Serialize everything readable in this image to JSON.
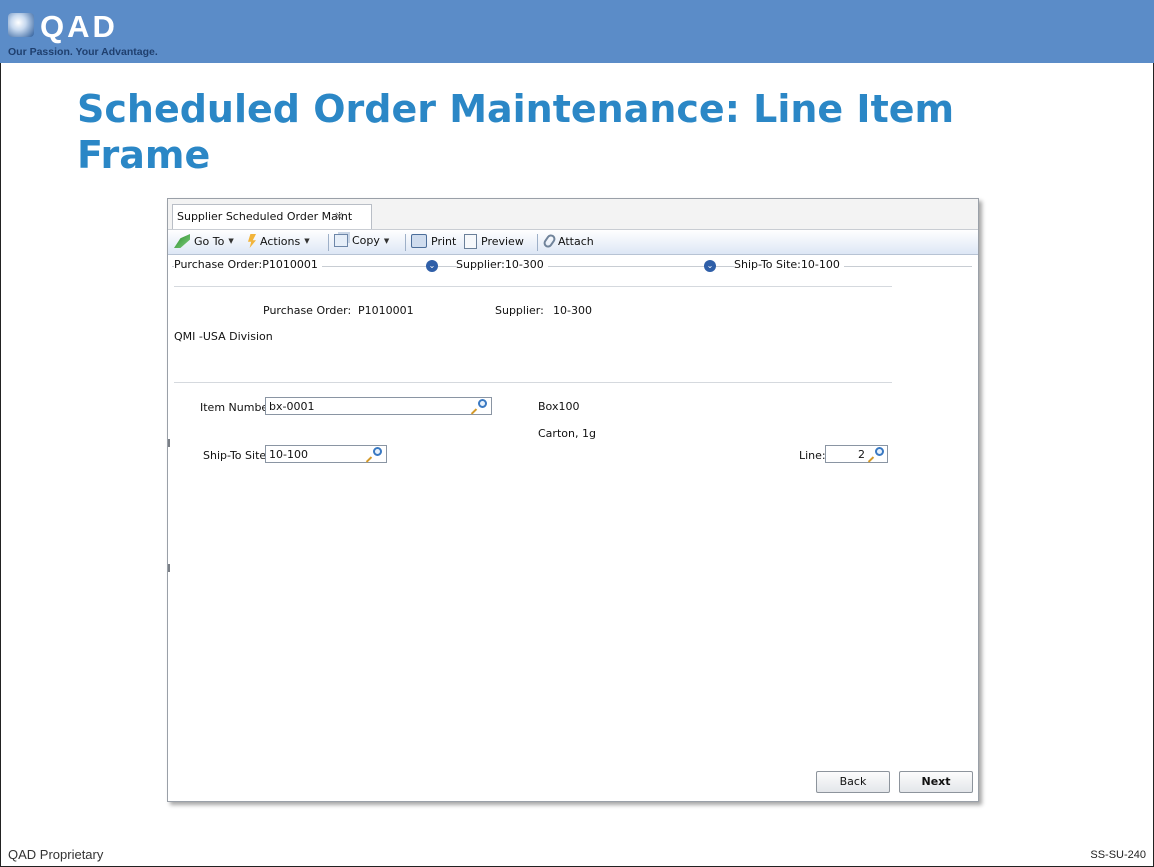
{
  "header": {
    "logo_text": "QAD",
    "tagline": "Our Passion. Your Advantage."
  },
  "slide": {
    "title": "Scheduled Order Maintenance: Line Item Frame"
  },
  "footer": {
    "left": "QAD Proprietary",
    "right": "SS-SU-240"
  },
  "app": {
    "tab_label": "Supplier Scheduled Order Maint",
    "tab_close": "×",
    "toolbar": {
      "goto": "Go To",
      "actions": "Actions",
      "copy": "Copy",
      "print": "Print",
      "preview": "Preview",
      "attach": "Attach"
    },
    "breadcrumb": {
      "purchase_order": "Purchase Order:P1010001",
      "supplier": "Supplier:10-300",
      "ship_to_site": "Ship-To Site:10-100"
    },
    "header_info": {
      "po_label": "Purchase Order:",
      "po_value": "P1010001",
      "supplier_label": "Supplier:",
      "supplier_value": "10-300",
      "division": "QMI -USA Division"
    },
    "form": {
      "item_label": "Item Number:",
      "item_value": "bx-0001",
      "item_desc1": "Box100",
      "item_desc2": "Carton, 1g",
      "site_label": "Ship-To Site:",
      "site_value": "10-100",
      "line_label": "Line:",
      "line_value": "2"
    },
    "buttons": {
      "back": "Back",
      "next": "Next"
    }
  }
}
